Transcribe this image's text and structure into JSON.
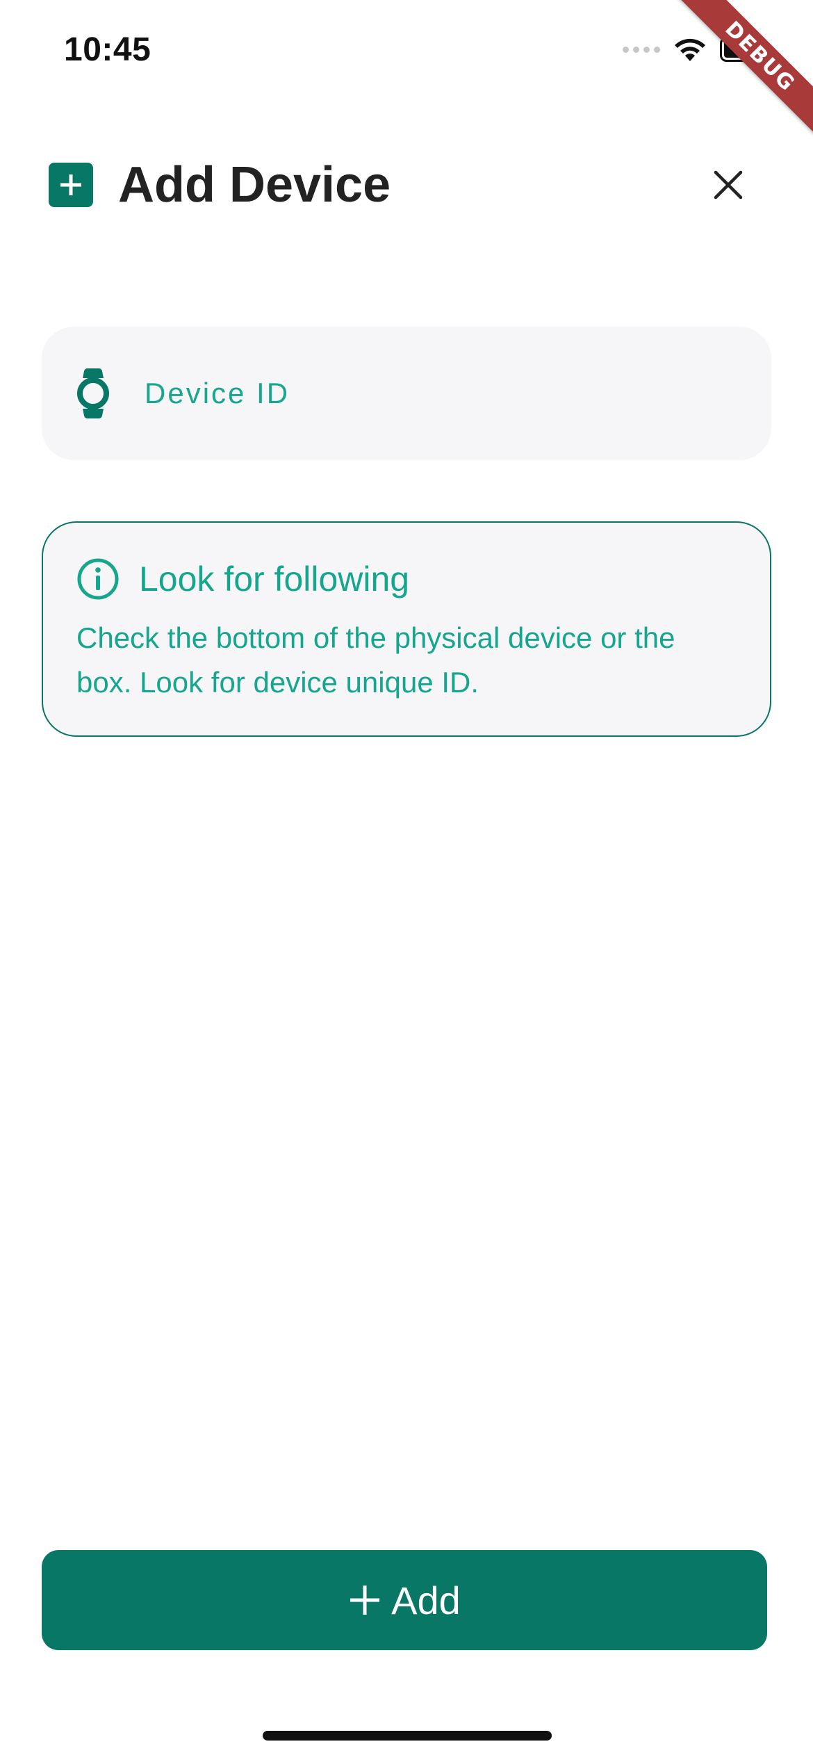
{
  "status_bar": {
    "time": "10:45",
    "signal_icon": "cellular-dots-icon",
    "wifi_icon": "wifi-icon",
    "battery_icon": "battery-icon"
  },
  "debug_banner": {
    "label": "DEBUG"
  },
  "header": {
    "icon": "plus-square-icon",
    "title": "Add Device",
    "close_icon": "close-icon"
  },
  "device_field": {
    "icon": "watch-icon",
    "placeholder": "Device ID",
    "value": ""
  },
  "info_card": {
    "icon": "info-circle-icon",
    "title": "Look for following",
    "body": "Check the bottom of the physical device or the box. Look for device unique ID."
  },
  "add_button": {
    "icon": "plus-icon",
    "label": "Add"
  },
  "colors": {
    "primary": "#087766",
    "accent_text": "#16a68d",
    "field_bg": "#f6f6f8",
    "debug_banner": "#a83a3a"
  }
}
